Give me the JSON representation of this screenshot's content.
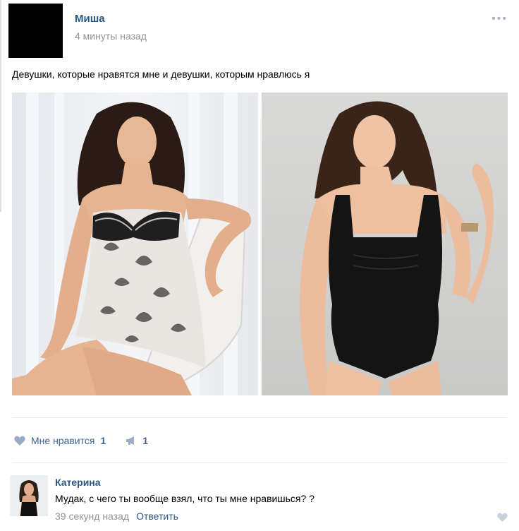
{
  "post": {
    "author": "Миша",
    "time": "4 минуты назад",
    "text": "Девушки, которые нравятся мне и девушки, которым нравлюсь я",
    "photos": [
      {
        "alt": "photo-left"
      },
      {
        "alt": "photo-right"
      }
    ],
    "actions": {
      "like_label": "Мне нравится",
      "like_count": "1",
      "share_count": "1"
    }
  },
  "comment": {
    "author": "Катерина",
    "text": "Мудак, с чего ты вообще взял, что ты мне нравишься? ?",
    "time": "39 секунд назад",
    "reply_label": "Ответить"
  },
  "colors": {
    "link": "#2a5885",
    "muted": "#939393",
    "icon": "#aab4c0"
  }
}
